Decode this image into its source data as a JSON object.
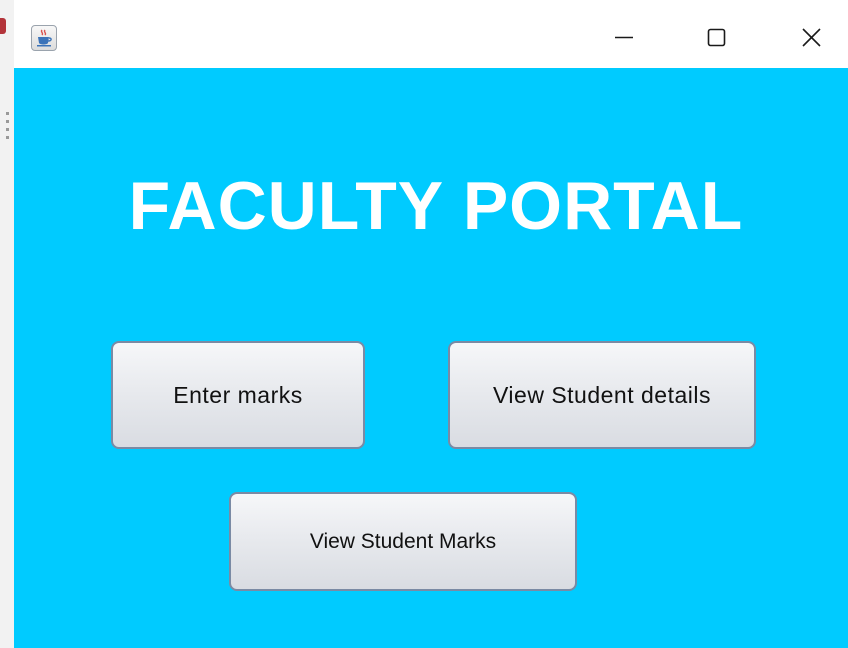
{
  "window": {
    "icon": "java-cup-icon",
    "controls": {
      "minimize_icon": "minimize-icon",
      "maximize_icon": "maximize-icon",
      "close_icon": "close-icon"
    }
  },
  "main": {
    "title": "FACULTY PORTAL",
    "buttons": {
      "enter_marks": "Enter marks",
      "view_student_details": "View Student details",
      "view_student_marks": "View Student Marks"
    }
  },
  "colors": {
    "background": "#00cbff",
    "title_text": "#ffffff",
    "button_border": "#7a8aa4"
  }
}
